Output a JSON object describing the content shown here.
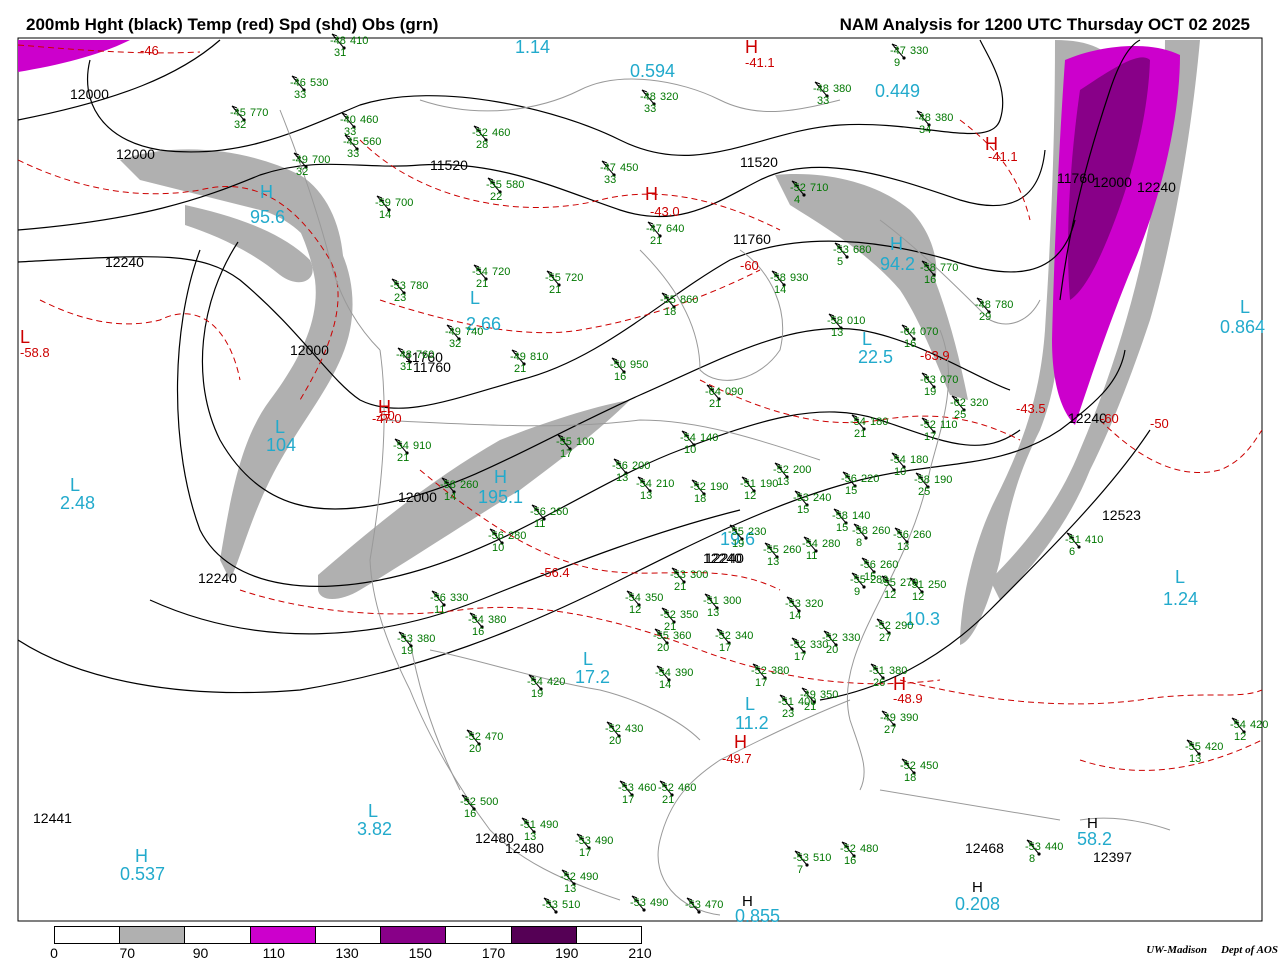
{
  "title_left": "200mb Hght (black) Temp (red) Spd (shd) Obs (grn)",
  "title_right": "NAM Analysis for 1200 UTC Thursday  OCT 02 2025",
  "credit": {
    "org": "UW-Madison",
    "dept": "Dept of AOS"
  },
  "colors": {
    "height": "#000000",
    "temp": "#cc0000",
    "obs": "#007700",
    "speed_label": "#22aacc",
    "shd_70": "#b0b0b0",
    "shd_110": "#cc00cc",
    "shd_150": "#880088",
    "shd_190": "#550055",
    "map": "#999999"
  },
  "colorbar": {
    "ticks": [
      "0",
      "70",
      "90",
      "110",
      "130",
      "150",
      "170",
      "190",
      "210"
    ],
    "segments": [
      "#ffffff",
      "#b0b0b0",
      "#ffffff",
      "#cc00cc",
      "#ffffff",
      "#880088",
      "#ffffff",
      "#550055",
      "#ffffff"
    ]
  },
  "height_labels": [
    "12000",
    "12000",
    "11520",
    "11520",
    "12240",
    "11760",
    "12000",
    "11760",
    "11760",
    "12000",
    "12240",
    "12240",
    "11760",
    "12000",
    "12240",
    "12240",
    "12523",
    "12441",
    "12480",
    "12480",
    "12468",
    "12397",
    "12240"
  ],
  "speed_labels": [
    "1.14",
    "0.594",
    "0.449",
    "95.6",
    "94.2",
    "2.66",
    "22.5",
    "104",
    "2.48",
    "195.1",
    "19.6",
    "10.3",
    "17.2",
    "11.2",
    "1.24",
    "0.864",
    "3.82",
    "0.537",
    "0.208",
    "0.855",
    "58.2"
  ],
  "high_low": [
    {
      "t": "H",
      "c": "temp"
    },
    {
      "t": "H",
      "c": "temp"
    },
    {
      "t": "H",
      "c": "temp"
    },
    {
      "t": "H",
      "c": "temp"
    },
    {
      "t": "L",
      "c": "temp"
    },
    {
      "t": "H",
      "c": "temp"
    },
    {
      "t": "H",
      "c": "temp"
    },
    {
      "t": "H",
      "c": "speed"
    },
    {
      "t": "H",
      "c": "speed"
    },
    {
      "t": "H",
      "c": "speed"
    },
    {
      "t": "L",
      "c": "speed"
    },
    {
      "t": "L",
      "c": "speed"
    },
    {
      "t": "L",
      "c": "speed"
    },
    {
      "t": "L",
      "c": "speed"
    },
    {
      "t": "L",
      "c": "speed"
    },
    {
      "t": "L",
      "c": "speed"
    },
    {
      "t": "L",
      "c": "speed"
    },
    {
      "t": "L",
      "c": "speed"
    },
    {
      "t": "L",
      "c": "speed"
    },
    {
      "t": "H",
      "c": "speed"
    },
    {
      "t": "H",
      "c": "height"
    },
    {
      "t": "H",
      "c": "height"
    },
    {
      "t": "H",
      "c": "height"
    }
  ],
  "temp_labels": [
    "-41.1",
    "-41.1",
    "-43.0",
    "-46",
    "-58.8",
    "-47.0",
    "-56.4",
    "-63.9",
    "-60",
    "-43.5",
    "-49.7",
    "-48.9",
    "-50",
    "-50",
    "-60"
  ],
  "obs": [
    {
      "t": "-45",
      "s": "770",
      "sp": "32"
    },
    {
      "t": "-48",
      "s": "410",
      "sp": "31"
    },
    {
      "t": "-46",
      "s": "530",
      "sp": "33"
    },
    {
      "t": "-40",
      "s": "460",
      "sp": "33"
    },
    {
      "t": "-49",
      "s": "700",
      "sp": "32"
    },
    {
      "t": "-45",
      "s": "560",
      "sp": "33"
    },
    {
      "t": "-48",
      "s": "380",
      "sp": "33"
    },
    {
      "t": "-47",
      "s": "330",
      "sp": "9"
    },
    {
      "t": "-48",
      "s": "380",
      "sp": "34"
    },
    {
      "t": "-48",
      "s": "320",
      "sp": "33"
    },
    {
      "t": "-52",
      "s": "460",
      "sp": "28"
    },
    {
      "t": "-47",
      "s": "450",
      "sp": "33"
    },
    {
      "t": "-55",
      "s": "580",
      "sp": "22"
    },
    {
      "t": "-59",
      "s": "700",
      "sp": "14"
    },
    {
      "t": "-47",
      "s": "640",
      "sp": "21"
    },
    {
      "t": "-52",
      "s": "710",
      "sp": "4"
    },
    {
      "t": "-53",
      "s": "680",
      "sp": "5"
    },
    {
      "t": "-58",
      "s": "770",
      "sp": "16"
    },
    {
      "t": "-54",
      "s": "720",
      "sp": "21"
    },
    {
      "t": "-55",
      "s": "720",
      "sp": "21"
    },
    {
      "t": "-53",
      "s": "780",
      "sp": "23"
    },
    {
      "t": "-58",
      "s": "930",
      "sp": "14"
    },
    {
      "t": "-55",
      "s": "860",
      "sp": "18"
    },
    {
      "t": "-48",
      "s": "780",
      "sp": "29"
    },
    {
      "t": "-49",
      "s": "740",
      "sp": "32"
    },
    {
      "t": "-48",
      "s": "760",
      "sp": "31"
    },
    {
      "t": "-58",
      "s": "010",
      "sp": "13"
    },
    {
      "t": "-64",
      "s": "070",
      "sp": "16"
    },
    {
      "t": "-49",
      "s": "810",
      "sp": "21"
    },
    {
      "t": "-50",
      "s": "950",
      "sp": "16"
    },
    {
      "t": "-64",
      "s": "090",
      "sp": "21"
    },
    {
      "t": "-63",
      "s": "070",
      "sp": "19"
    },
    {
      "t": "-62",
      "s": "320",
      "sp": "25"
    },
    {
      "t": "-54",
      "s": "180",
      "sp": "21"
    },
    {
      "t": "-52",
      "s": "110",
      "sp": "17"
    },
    {
      "t": "-54",
      "s": "910",
      "sp": "21"
    },
    {
      "t": "-55",
      "s": "100",
      "sp": "17"
    },
    {
      "t": "-54",
      "s": "140",
      "sp": "10"
    },
    {
      "t": "-54",
      "s": "180",
      "sp": "10"
    },
    {
      "t": "-56",
      "s": "200",
      "sp": "13"
    },
    {
      "t": "-58",
      "s": "190",
      "sp": "25"
    },
    {
      "t": "-54",
      "s": "210",
      "sp": "13"
    },
    {
      "t": "-52",
      "s": "190",
      "sp": "18"
    },
    {
      "t": "-51",
      "s": "190",
      "sp": "12"
    },
    {
      "t": "-52",
      "s": "200",
      "sp": "13"
    },
    {
      "t": "-56",
      "s": "220",
      "sp": "15"
    },
    {
      "t": "-53",
      "s": "240",
      "sp": "15"
    },
    {
      "t": "-58",
      "s": "140",
      "sp": "15"
    },
    {
      "t": "-58",
      "s": "260",
      "sp": "14"
    },
    {
      "t": "-56",
      "s": "260",
      "sp": "11"
    },
    {
      "t": "-56",
      "s": "280",
      "sp": "10"
    },
    {
      "t": "-55",
      "s": "230",
      "sp": "19"
    },
    {
      "t": "-55",
      "s": "260",
      "sp": "13"
    },
    {
      "t": "-54",
      "s": "280",
      "sp": "11"
    },
    {
      "t": "-58",
      "s": "260",
      "sp": "8"
    },
    {
      "t": "-56",
      "s": "260",
      "sp": "15"
    },
    {
      "t": "-55",
      "s": "280",
      "sp": "9"
    },
    {
      "t": "-56",
      "s": "260",
      "sp": "13"
    },
    {
      "t": "-56",
      "s": "330",
      "sp": "11"
    },
    {
      "t": "-53",
      "s": "300",
      "sp": "21"
    },
    {
      "t": "-54",
      "s": "350",
      "sp": "12"
    },
    {
      "t": "-52",
      "s": "350",
      "sp": "21"
    },
    {
      "t": "-51",
      "s": "300",
      "sp": "13"
    },
    {
      "t": "-53",
      "s": "320",
      "sp": "14"
    },
    {
      "t": "-55",
      "s": "270",
      "sp": "12"
    },
    {
      "t": "-51",
      "s": "250",
      "sp": "12"
    },
    {
      "t": "-54",
      "s": "380",
      "sp": "16"
    },
    {
      "t": "-53",
      "s": "380",
      "sp": "19"
    },
    {
      "t": "-55",
      "s": "360",
      "sp": "20"
    },
    {
      "t": "-52",
      "s": "340",
      "sp": "17"
    },
    {
      "t": "-52",
      "s": "330",
      "sp": "17"
    },
    {
      "t": "-52",
      "s": "330",
      "sp": "20"
    },
    {
      "t": "-52",
      "s": "290",
      "sp": "27"
    },
    {
      "t": "-54",
      "s": "420",
      "sp": "19"
    },
    {
      "t": "-54",
      "s": "390",
      "sp": "14"
    },
    {
      "t": "-52",
      "s": "380",
      "sp": "17"
    },
    {
      "t": "-51",
      "s": "400",
      "sp": "23"
    },
    {
      "t": "-49",
      "s": "350",
      "sp": "21"
    },
    {
      "t": "-51",
      "s": "380",
      "sp": "26"
    },
    {
      "t": "-49",
      "s": "390",
      "sp": "27"
    },
    {
      "t": "-51",
      "s": "410",
      "sp": "6"
    },
    {
      "t": "-52",
      "s": "470",
      "sp": "20"
    },
    {
      "t": "-52",
      "s": "430",
      "sp": "20"
    },
    {
      "t": "-52",
      "s": "450",
      "sp": "18"
    },
    {
      "t": "-52",
      "s": "500",
      "sp": "16"
    },
    {
      "t": "-53",
      "s": "460",
      "sp": "17"
    },
    {
      "t": "-52",
      "s": "460",
      "sp": "21"
    },
    {
      "t": "-51",
      "s": "490",
      "sp": "13"
    },
    {
      "t": "-53",
      "s": "490",
      "sp": "17"
    },
    {
      "t": "-52",
      "s": "490",
      "sp": "13"
    },
    {
      "t": "-53",
      "s": "510",
      "sp": "7"
    },
    {
      "t": "-52",
      "s": "480",
      "sp": "16"
    },
    {
      "t": "-53",
      "s": "440",
      "sp": "8"
    },
    {
      "t": "-55",
      "s": "420",
      "sp": "13"
    },
    {
      "t": "-54",
      "s": "420",
      "sp": "12"
    },
    {
      "t": "-53",
      "s": "510",
      "sp": ""
    },
    {
      "t": "-53",
      "s": "490",
      "sp": ""
    },
    {
      "t": "-53",
      "s": "470",
      "sp": ""
    }
  ]
}
